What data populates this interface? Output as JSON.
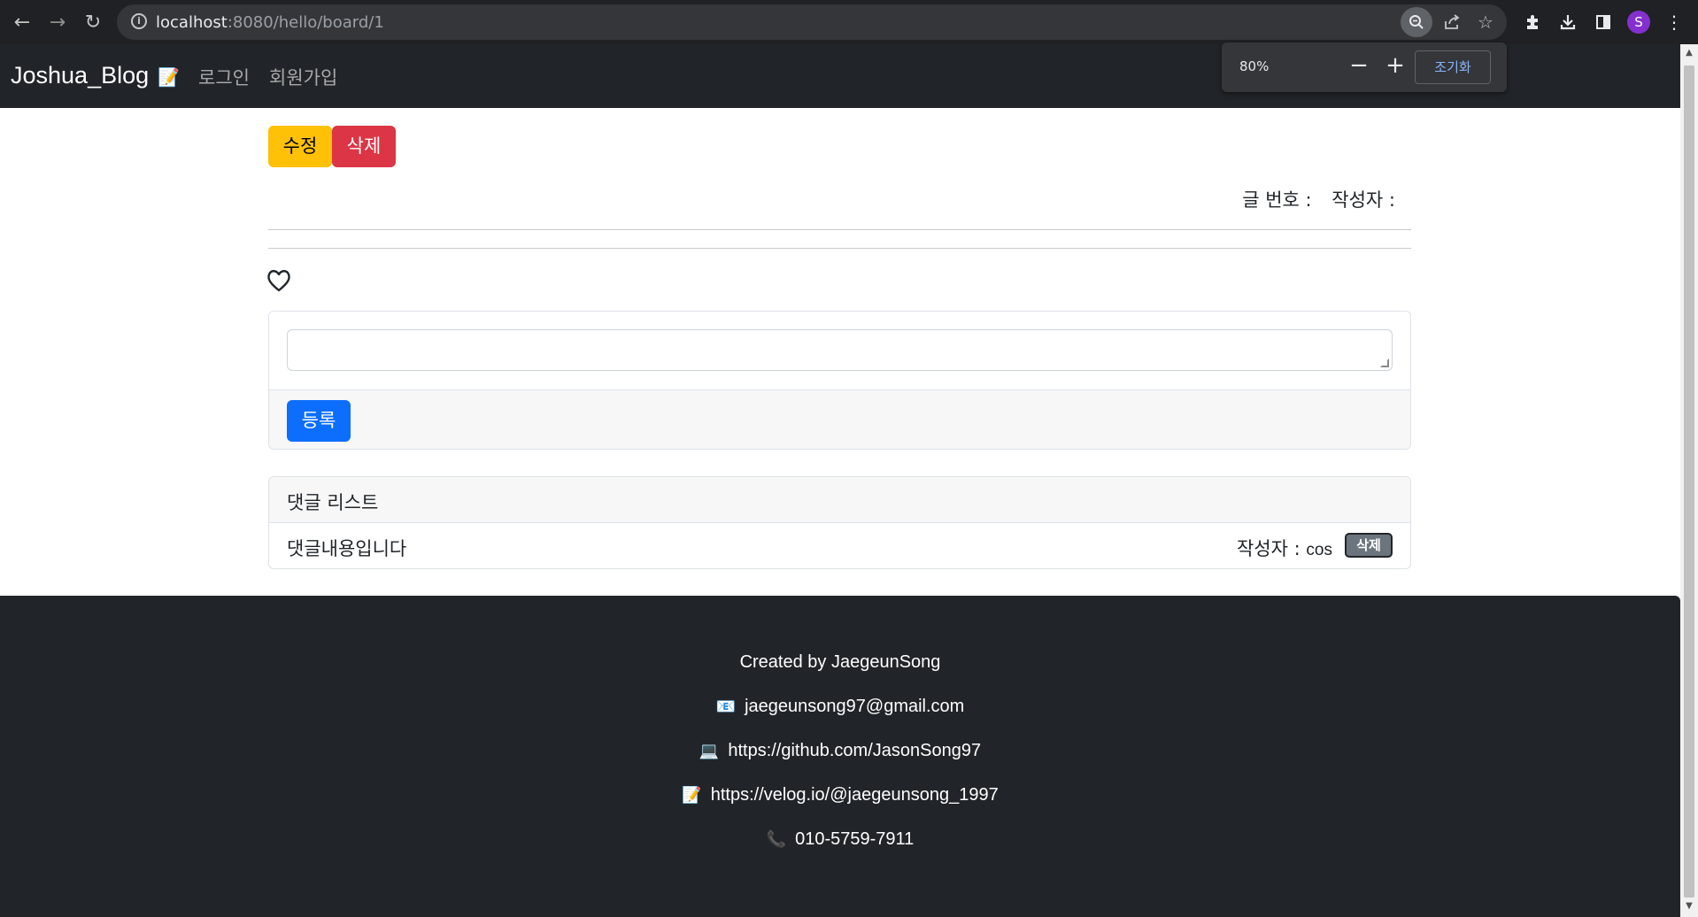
{
  "browser": {
    "url_host": "localhost",
    "url_path": ":8080/hello/board/1",
    "avatar_letter": "S",
    "zoom_popup": {
      "level": "80%",
      "minus": "−",
      "plus": "+",
      "reset_label": "조기화"
    }
  },
  "navbar": {
    "brand": "Joshua_Blog",
    "brand_emoji": "📝",
    "links": [
      "로그인",
      "회원가입"
    ]
  },
  "post": {
    "edit_label": "수정",
    "delete_label": "삭제",
    "number_label": "글 번호 :",
    "author_label": "작성자 :"
  },
  "reply_form": {
    "textarea_value": "",
    "submit_label": "등록"
  },
  "reply_list": {
    "title": "댓글 리스트",
    "items": [
      {
        "content": "댓글내용입니다",
        "author_label": "작성자 :",
        "author": "cos",
        "delete_label": "삭제"
      }
    ]
  },
  "footer": {
    "created_by": "Created by JaegeunSong",
    "email": "jaegeunsong97@gmail.com",
    "github": "https://github.com/JasonSong97",
    "velog": "https://velog.io/@jaegeunsong_1997",
    "phone": "010-5759-7911"
  },
  "colors": {
    "warning": "#ffc107",
    "danger": "#dc3545",
    "primary": "#0d6efd",
    "secondary": "#6c757d",
    "dark": "#212529"
  }
}
